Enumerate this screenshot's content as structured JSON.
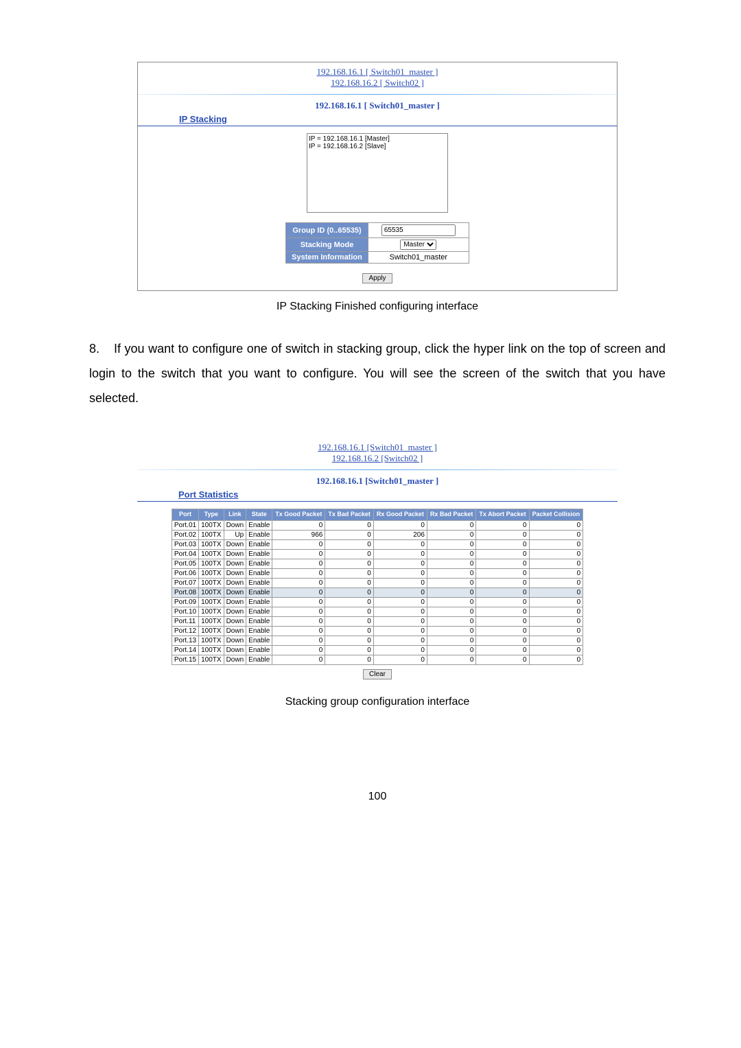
{
  "figure1": {
    "link1_ip": "192.168.16.1",
    "link1_name": "[ Switch01_master ]",
    "link2_ip": "192.168.16.2",
    "link2_name": "[ Switch02 ]",
    "title_ip": "192.168.16.1",
    "title_name": "[ Switch01_master ]",
    "heading": "IP Stacking",
    "list_item1": "IP = 192.168.16.1 [Master]",
    "list_item2": "IP = 192.168.16.2 [Slave]",
    "row_group_label": "Group ID (0..65535)",
    "row_group_value": "65535",
    "row_mode_label": "Stacking Mode",
    "row_mode_value": "Master",
    "row_sysinfo_label": "System Information",
    "row_sysinfo_value": "Switch01_master",
    "apply_btn": "Apply",
    "caption": "IP Stacking Finished configuring interface"
  },
  "body": {
    "item_number": "8.",
    "para": "If you want to configure one of switch in stacking group, click the hyper link on the top of screen and login to the switch that you want to configure. You will see the screen of the switch that you have selected."
  },
  "figure2": {
    "link1_ip": "192.168.16.1",
    "link1_name": "[Switch01_master ]",
    "link2_ip": "192.168.16.2",
    "link2_name": "[Switch02 ]",
    "title_ip": "192.168.16.1",
    "title_name": "[Switch01_master ]",
    "heading": "Port Statistics",
    "headers": {
      "port": "Port",
      "type": "Type",
      "link": "Link",
      "state": "State",
      "txgood": "Tx Good Packet",
      "txbad": "Tx Bad Packet",
      "rxgood": "Rx Good Packet",
      "rxbad": "Rx Bad Packet",
      "txabort": "Tx Abort Packet",
      "collision": "Packet Collision"
    },
    "rows": [
      {
        "port": "Port.01",
        "type": "100TX",
        "link": "Down",
        "state": "Enable",
        "txg": "0",
        "txb": "0",
        "rxg": "0",
        "rxb": "0",
        "txa": "0",
        "col": "0",
        "hl": false
      },
      {
        "port": "Port.02",
        "type": "100TX",
        "link": "Up",
        "state": "Enable",
        "txg": "966",
        "txb": "0",
        "rxg": "206",
        "rxb": "0",
        "txa": "0",
        "col": "0",
        "hl": false
      },
      {
        "port": "Port.03",
        "type": "100TX",
        "link": "Down",
        "state": "Enable",
        "txg": "0",
        "txb": "0",
        "rxg": "0",
        "rxb": "0",
        "txa": "0",
        "col": "0",
        "hl": false
      },
      {
        "port": "Port.04",
        "type": "100TX",
        "link": "Down",
        "state": "Enable",
        "txg": "0",
        "txb": "0",
        "rxg": "0",
        "rxb": "0",
        "txa": "0",
        "col": "0",
        "hl": false
      },
      {
        "port": "Port.05",
        "type": "100TX",
        "link": "Down",
        "state": "Enable",
        "txg": "0",
        "txb": "0",
        "rxg": "0",
        "rxb": "0",
        "txa": "0",
        "col": "0",
        "hl": false
      },
      {
        "port": "Port.06",
        "type": "100TX",
        "link": "Down",
        "state": "Enable",
        "txg": "0",
        "txb": "0",
        "rxg": "0",
        "rxb": "0",
        "txa": "0",
        "col": "0",
        "hl": false
      },
      {
        "port": "Port.07",
        "type": "100TX",
        "link": "Down",
        "state": "Enable",
        "txg": "0",
        "txb": "0",
        "rxg": "0",
        "rxb": "0",
        "txa": "0",
        "col": "0",
        "hl": false
      },
      {
        "port": "Port.08",
        "type": "100TX",
        "link": "Down",
        "state": "Enable",
        "txg": "0",
        "txb": "0",
        "rxg": "0",
        "rxb": "0",
        "txa": "0",
        "col": "0",
        "hl": true
      },
      {
        "port": "Port.09",
        "type": "100TX",
        "link": "Down",
        "state": "Enable",
        "txg": "0",
        "txb": "0",
        "rxg": "0",
        "rxb": "0",
        "txa": "0",
        "col": "0",
        "hl": false
      },
      {
        "port": "Port.10",
        "type": "100TX",
        "link": "Down",
        "state": "Enable",
        "txg": "0",
        "txb": "0",
        "rxg": "0",
        "rxb": "0",
        "txa": "0",
        "col": "0",
        "hl": false
      },
      {
        "port": "Port.11",
        "type": "100TX",
        "link": "Down",
        "state": "Enable",
        "txg": "0",
        "txb": "0",
        "rxg": "0",
        "rxb": "0",
        "txa": "0",
        "col": "0",
        "hl": false
      },
      {
        "port": "Port.12",
        "type": "100TX",
        "link": "Down",
        "state": "Enable",
        "txg": "0",
        "txb": "0",
        "rxg": "0",
        "rxb": "0",
        "txa": "0",
        "col": "0",
        "hl": false
      },
      {
        "port": "Port.13",
        "type": "100TX",
        "link": "Down",
        "state": "Enable",
        "txg": "0",
        "txb": "0",
        "rxg": "0",
        "rxb": "0",
        "txa": "0",
        "col": "0",
        "hl": false
      },
      {
        "port": "Port.14",
        "type": "100TX",
        "link": "Down",
        "state": "Enable",
        "txg": "0",
        "txb": "0",
        "rxg": "0",
        "rxb": "0",
        "txa": "0",
        "col": "0",
        "hl": false
      },
      {
        "port": "Port.15",
        "type": "100TX",
        "link": "Down",
        "state": "Enable",
        "txg": "0",
        "txb": "0",
        "rxg": "0",
        "rxb": "0",
        "txa": "0",
        "col": "0",
        "hl": false
      }
    ],
    "clear_btn": "Clear",
    "caption": "Stacking group configuration interface"
  },
  "page_number": "100"
}
